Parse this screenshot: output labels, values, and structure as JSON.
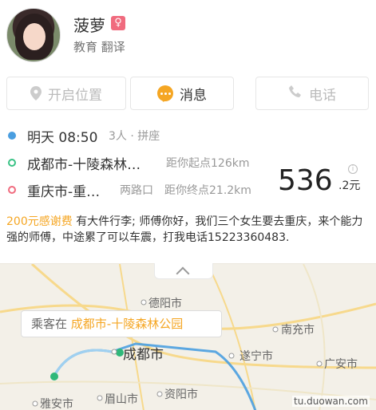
{
  "profile": {
    "name": "菠萝",
    "gender_icon": "♀",
    "tags": "教育 翻译"
  },
  "actions": {
    "location": "开启位置",
    "message": "消息",
    "phone": "电话"
  },
  "trip": {
    "time": "明天 08:50",
    "seats": "3人 · 拼座",
    "start": "成都市-十陵森林…",
    "start_distance": "距你起点126km",
    "end": "重庆市-重…",
    "end_road": "两路口",
    "end_distance": "距你终点21.2km",
    "price": "536",
    "price_unit": ".2元"
  },
  "note": {
    "tip": "200元感谢费",
    "text": "有大件行李; 师傅你好，我们三个女生要去重庆，来个能力强的师傅，中途累了可以车震，打我电话15223360483."
  },
  "map": {
    "callout_prefix": "乘客在",
    "callout_place": "成都市-十陵森林公园",
    "cities": [
      "德阳市",
      "成都市",
      "遂宁市",
      "南充市",
      "广安市",
      "眉山市",
      "资阳市",
      "雅安市"
    ],
    "watermark": "tu.duowan.com"
  },
  "colors": {
    "accent": "#f5a623",
    "start": "#39c285",
    "end": "#f06b7e",
    "route": "#4a9ee0"
  }
}
